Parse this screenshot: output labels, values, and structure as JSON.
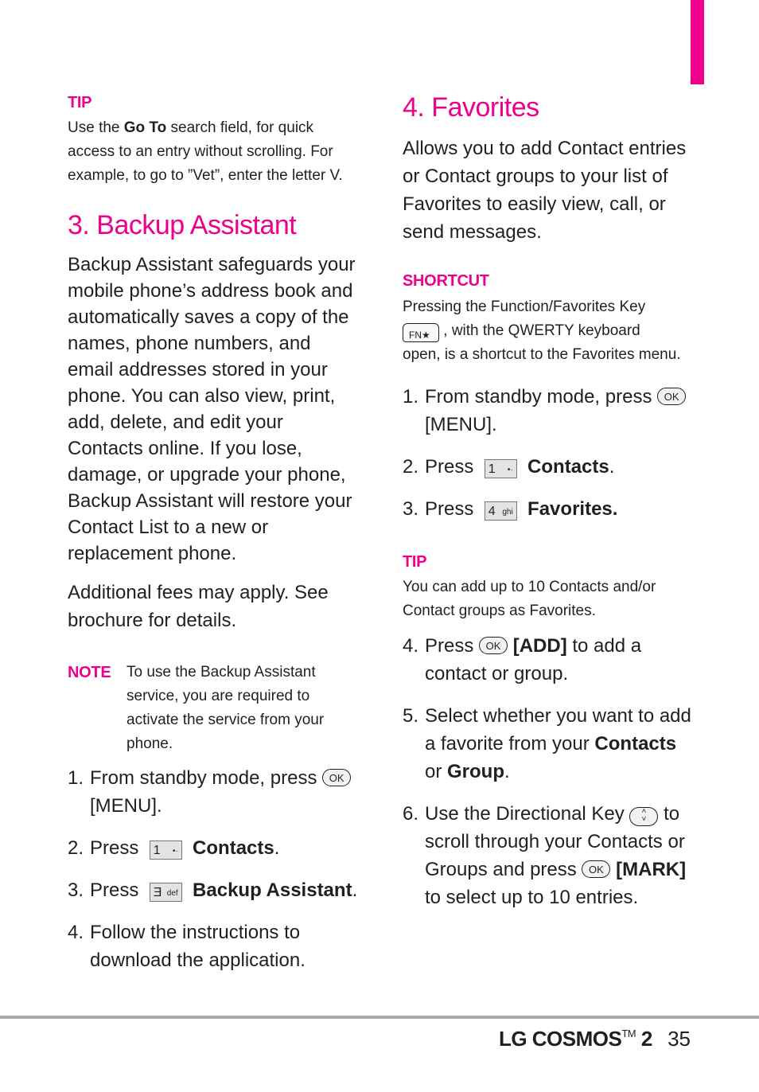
{
  "page": {
    "accent_color": "#ec008c",
    "footer": {
      "brand": "LG COSMOS",
      "trademark": "TM",
      "model_number": "2",
      "page_number": "35"
    }
  },
  "left": {
    "tip": {
      "label": "TIP",
      "text_before": "Use the ",
      "bold": "Go To",
      "text_after": " search field, for quick access to an entry without scrolling.  For example, to go to ”Vet”, enter the letter V."
    },
    "heading": "3. Backup Assistant",
    "paragraph1": "Backup Assistant safeguards your mobile phone’s address book and automatically saves a copy of the names, phone numbers, and email addresses stored in your phone. You can also view, print, add, delete, and edit your Contacts online. If you lose, damage, or upgrade your phone, Backup Assistant will restore your Contact List to a new or replacement phone.",
    "paragraph2": "Additional fees may apply. See brochure for details.",
    "note": {
      "label": "NOTE",
      "text": "To use the Backup Assistant service, you are required to activate the service from your phone."
    },
    "steps": [
      {
        "num": "1.",
        "text": "From standby mode, press",
        "key": "OK",
        "after_bold": "[MENU]",
        "after": "."
      },
      {
        "num": "2.",
        "text": "Press",
        "key_num": "1",
        "key_sub": "•·",
        "bold": "Contacts",
        "after": "."
      },
      {
        "num": "3.",
        "text": "Press",
        "key_num": "Ǝ",
        "key_sub": "def",
        "bold": "Backup Assistant",
        "after": "."
      },
      {
        "num": "4.",
        "text": "Follow the instructions to download the application."
      }
    ]
  },
  "right": {
    "heading": "4. Favorites",
    "paragraph": "Allows you to add Contact entries or Contact groups to your list of Favorites to easily view, call, or send messages.",
    "shortcut": {
      "label": "SHORTCUT",
      "text1": "Pressing the Function/Favorites Key",
      "key": "FN★",
      "text2": ", with the QWERTY keyboard",
      "text3": "open, is a shortcut to the Favorites menu."
    },
    "steps_a": [
      {
        "num": "1.",
        "text": "From standby mode, press",
        "key": "OK",
        "after_bold": "[MENU]",
        "after": "."
      },
      {
        "num": "2.",
        "text": "Press",
        "key_num": "1",
        "key_sub": "•·",
        "bold": "Contacts",
        "after": "."
      },
      {
        "num": "3.",
        "text": "Press",
        "key_num": "4",
        "key_sub": "ghi",
        "bold": "Favorites."
      }
    ],
    "tip": {
      "label": "TIP",
      "text": "You can add up to 10 Contacts and/or Contact groups as Favorites."
    },
    "steps_b": [
      {
        "num": "4.",
        "text": "Press",
        "key": "OK",
        "bold": "[ADD]",
        "after": " to add a contact or group."
      },
      {
        "num": "5.",
        "text": "Select whether you want to add a favorite from your ",
        "bold1": "Contacts",
        "mid": " or ",
        "bold2": "Group",
        "after": "."
      },
      {
        "num": "6.",
        "text": "Use the Directional Key",
        "dir_key": "˄˅",
        "text2": " to scroll through your Contacts or Groups and press",
        "key": "OK",
        "bold": "[MARK]",
        "after": " to select up to 10 entries."
      }
    ]
  }
}
